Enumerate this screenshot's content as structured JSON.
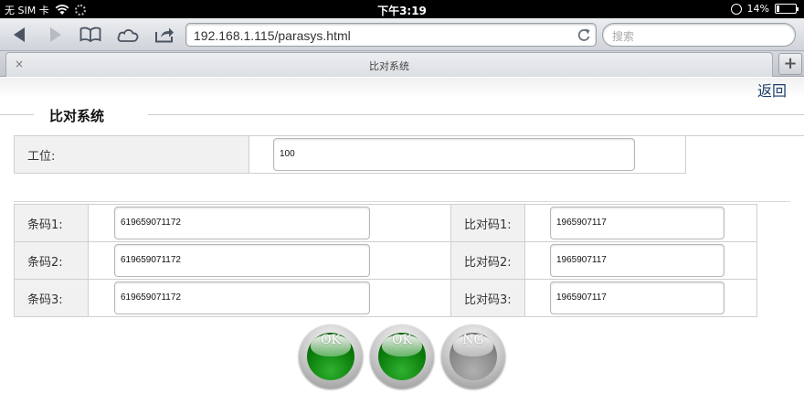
{
  "status_bar": {
    "carrier": "无 SIM 卡",
    "time": "下午3:19",
    "battery": "14%",
    "battery_level_percent": 14
  },
  "browser": {
    "url": "192.168.1.115/parasys.html",
    "search_placeholder": "搜索",
    "tab_title": "比对系统",
    "new_tab": "+",
    "close_tab": "×"
  },
  "page": {
    "back_link": "返回",
    "legend": "比对系统",
    "station": {
      "label": "工位:",
      "value": "100"
    },
    "rows": [
      {
        "barcode_label": "条码1:",
        "barcode_value": "619659071172",
        "compare_label": "比对码1:",
        "compare_value": "1965907117"
      },
      {
        "barcode_label": "条码2:",
        "barcode_value": "619659071172",
        "compare_label": "比对码2:",
        "compare_value": "1965907117"
      },
      {
        "barcode_label": "条码3:",
        "barcode_value": "619659071172",
        "compare_label": "比对码3:",
        "compare_value": "1965907117"
      }
    ],
    "results": [
      {
        "label": "OK",
        "state": "ok",
        "color": "#0b7d0b"
      },
      {
        "label": "OK",
        "state": "ok",
        "color": "#0b7d0b"
      },
      {
        "label": "NG",
        "state": "ng",
        "color": "#8a8a8a"
      }
    ]
  }
}
